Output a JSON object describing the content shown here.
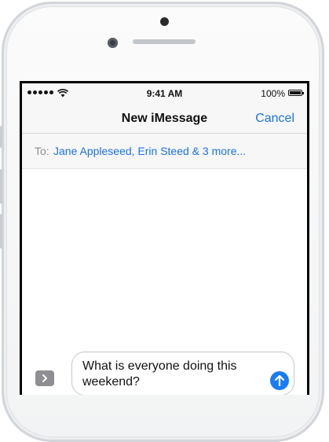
{
  "status_bar": {
    "time": "9:41 AM",
    "battery": "100%",
    "signal_icon": "signal-dots-icon",
    "wifi_icon": "wifi-icon",
    "battery_icon": "battery-icon"
  },
  "nav": {
    "title": "New iMessage",
    "cancel_label": "Cancel"
  },
  "compose": {
    "to_label": "To:",
    "recipients": "Jane Appleseed, Erin Steed & 3 more..."
  },
  "input": {
    "value": "What is everyone doing this weekend?",
    "expand_icon": "chevron-right-icon",
    "send_icon": "arrow-up-icon"
  },
  "colors": {
    "accent": "#1a73e8",
    "send_button": "#1b7cf5",
    "bar_background": "#f7f7f7",
    "secondary_text": "#8e8e93"
  }
}
